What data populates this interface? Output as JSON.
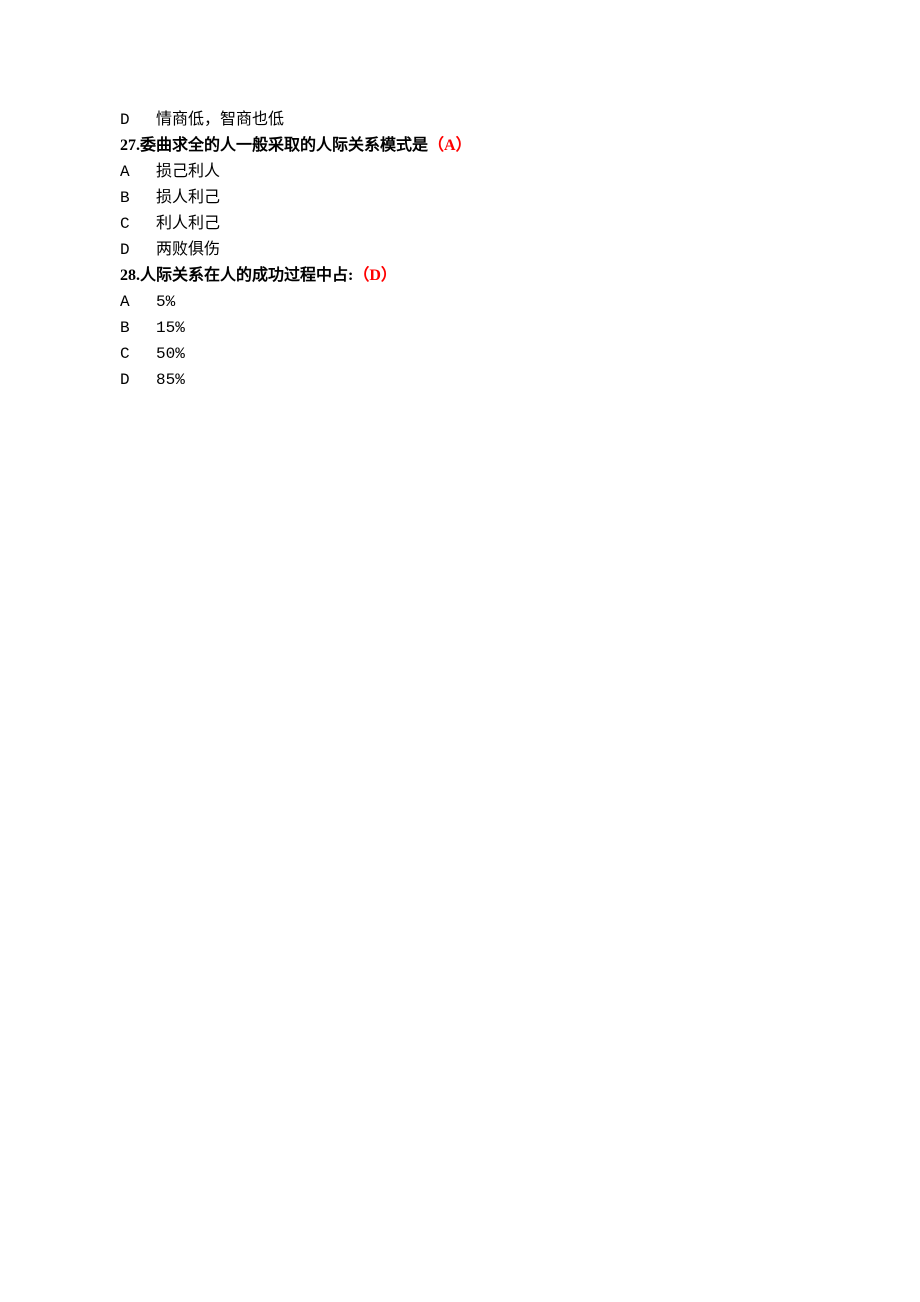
{
  "prev_option": {
    "letter": "D",
    "text": "情商低，智商也低"
  },
  "questions": [
    {
      "number": "27.",
      "text": "委曲求全的人一般采取的人际关系模式是",
      "answer": "（A）",
      "options": [
        {
          "letter": "A",
          "text": "损己利人"
        },
        {
          "letter": "B",
          "text": "损人利己"
        },
        {
          "letter": "C",
          "text": "利人利己"
        },
        {
          "letter": "D",
          "text": "两败俱伤"
        }
      ]
    },
    {
      "number": "28.",
      "text": "人际关系在人的成功过程中占:",
      "answer": "（D）",
      "options": [
        {
          "letter": "A",
          "text": "5%"
        },
        {
          "letter": "B",
          "text": "15%"
        },
        {
          "letter": "C",
          "text": "50%"
        },
        {
          "letter": "D",
          "text": "85%"
        }
      ]
    }
  ]
}
